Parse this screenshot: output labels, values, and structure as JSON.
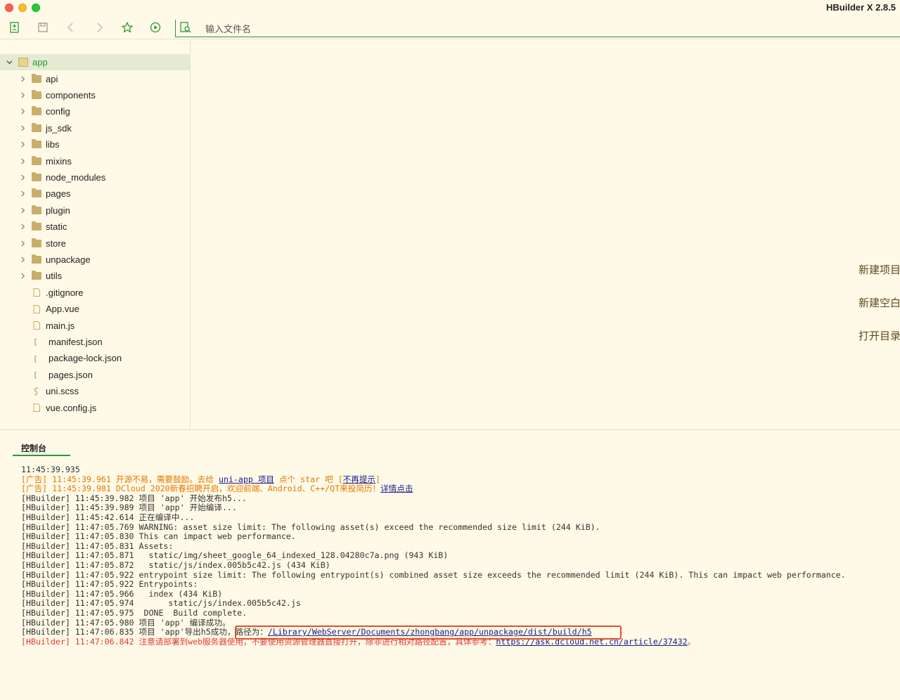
{
  "window": {
    "title": "HBuilder X 2.8.5"
  },
  "toolbar": {
    "search_placeholder": "输入文件名",
    "icons": [
      "new-file-icon",
      "save-icon",
      "back-icon",
      "forward-icon",
      "star-icon",
      "run-icon",
      "file-search-icon"
    ]
  },
  "tree": {
    "root": "app",
    "items": [
      {
        "label": "api",
        "type": "folder"
      },
      {
        "label": "components",
        "type": "folder"
      },
      {
        "label": "config",
        "type": "folder"
      },
      {
        "label": "js_sdk",
        "type": "folder"
      },
      {
        "label": "libs",
        "type": "folder"
      },
      {
        "label": "mixins",
        "type": "folder"
      },
      {
        "label": "node_modules",
        "type": "folder"
      },
      {
        "label": "pages",
        "type": "folder"
      },
      {
        "label": "plugin",
        "type": "folder"
      },
      {
        "label": "static",
        "type": "folder"
      },
      {
        "label": "store",
        "type": "folder"
      },
      {
        "label": "unpackage",
        "type": "folder"
      },
      {
        "label": "utils",
        "type": "folder"
      },
      {
        "label": ".gitignore",
        "type": "file"
      },
      {
        "label": "App.vue",
        "type": "file"
      },
      {
        "label": "main.js",
        "type": "file"
      },
      {
        "label": "manifest.json",
        "type": "json"
      },
      {
        "label": "package-lock.json",
        "type": "json"
      },
      {
        "label": "pages.json",
        "type": "json"
      },
      {
        "label": "uni.scss",
        "type": "scss"
      },
      {
        "label": "vue.config.js",
        "type": "file"
      }
    ]
  },
  "welcome": {
    "new_project": "新建项目",
    "new_blank": "新建空白",
    "open_dir": "打开目录"
  },
  "console": {
    "tab": "控制台",
    "lines": [
      {
        "text": "11:45:39.935",
        "color": "normal"
      },
      {
        "color": "orange",
        "parts": [
          {
            "t": "[广告] 11:45:39.961 开源不易，需要鼓励。去给 "
          },
          {
            "t": "uni-app 项目",
            "link": true
          },
          {
            "t": " 点个 star 吧 ["
          },
          {
            "t": "不再提示",
            "link": true
          },
          {
            "t": "]"
          }
        ]
      },
      {
        "color": "orange",
        "parts": [
          {
            "t": "[广告] 11:45:39.981 DCloud 2020新春招聘开启，欢迎前端、Android、C++/QT来投简历！"
          },
          {
            "t": "详情点击",
            "link": true
          }
        ]
      },
      {
        "text": "[HBuilder] 11:45:39.982 项目 'app' 开始发布h5...",
        "color": "normal"
      },
      {
        "text": "[HBuilder] 11:45:39.989 项目 'app' 开始编译...",
        "color": "normal"
      },
      {
        "text": "[HBuilder] 11:45:42.614 正在编译中...",
        "color": "normal"
      },
      {
        "text": "[HBuilder] 11:47:05.769 WARNING: asset size limit: The following asset(s) exceed the recommended size limit (244 KiB).",
        "color": "normal"
      },
      {
        "text": "[HBuilder] 11:47:05.830 This can impact web performance.",
        "color": "normal"
      },
      {
        "text": "[HBuilder] 11:47:05.831 Assets:",
        "color": "normal"
      },
      {
        "text": "[HBuilder] 11:47:05.871   static/img/sheet_google_64_indexed_128.04280c7a.png (943 KiB)",
        "color": "normal"
      },
      {
        "text": "[HBuilder] 11:47:05.872   static/js/index.005b5c42.js (434 KiB)",
        "color": "normal"
      },
      {
        "text": "[HBuilder] 11:47:05.922 entrypoint size limit: The following entrypoint(s) combined asset size exceeds the recommended limit (244 KiB). This can impact web performance.",
        "color": "normal"
      },
      {
        "text": "[HBuilder] 11:47:05.922 Entrypoints:",
        "color": "normal"
      },
      {
        "text": "[HBuilder] 11:47:05.966   index (434 KiB)",
        "color": "normal"
      },
      {
        "text": "[HBuilder] 11:47:05.974       static/js/index.005b5c42.js",
        "color": "normal"
      },
      {
        "text": "[HBuilder] 11:47:05.975  DONE  Build complete.",
        "color": "normal"
      },
      {
        "text": "[HBuilder] 11:47:05.980 项目 'app' 编译成功。",
        "color": "normal"
      },
      {
        "color": "normal",
        "parts": [
          {
            "t": "[HBuilder] 11:47:06.835 项目 'app'导出h5成功，路径为："
          },
          {
            "t": "/Library/WebServer/Documents/zhongbang/app/unpackage/dist/build/h5",
            "link": true
          }
        ]
      },
      {
        "color": "red",
        "parts": [
          {
            "t": "[HBuilder] 11:47:06.842 注意请部署到web服务器使用，不要使用资源管理器直接打开，除非进行相对路径配置，具体参考："
          },
          {
            "t": "https://ask.dcloud.net.cn/article/37432",
            "link": true
          },
          {
            "t": "。"
          }
        ]
      }
    ]
  },
  "colors": {
    "accent": "#2b9939",
    "background": "#fffae7",
    "highlight": "#e0502a"
  }
}
